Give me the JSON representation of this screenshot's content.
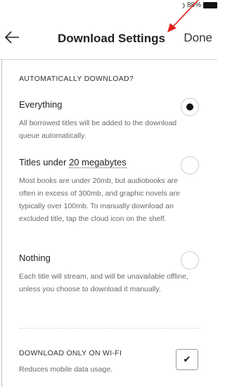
{
  "status_bar": {
    "battery_percent": "88%"
  },
  "header": {
    "title": "Download Settings",
    "done_label": "Done",
    "back_icon": "arrow-left-icon"
  },
  "auto_download": {
    "section_label": "AUTOMATICALLY DOWNLOAD?",
    "options": [
      {
        "title": "Everything",
        "description": "All borrowed titles will be added to the download queue automatically.",
        "selected": true
      },
      {
        "title_prefix": "Titles under ",
        "title_link": "20 megabytes",
        "description": "Most books are under 20mb, but audiobooks are often in excess of 300mb, and graphic novels are typically over 100mb. To manually download an excluded title, tap the cloud icon on the shelf.",
        "selected": false
      },
      {
        "title": "Nothing",
        "description": "Each title will stream, and will be unavailable offline, unless you choose to download it manually.",
        "selected": false
      }
    ]
  },
  "wifi_only": {
    "label": "DOWNLOAD ONLY ON WI-FI",
    "description": "Reduces mobile data usage.",
    "checked": true,
    "check_glyph": "✔"
  },
  "colors": {
    "annotation_arrow": "#e0201b",
    "radio_selected": "#111111"
  }
}
